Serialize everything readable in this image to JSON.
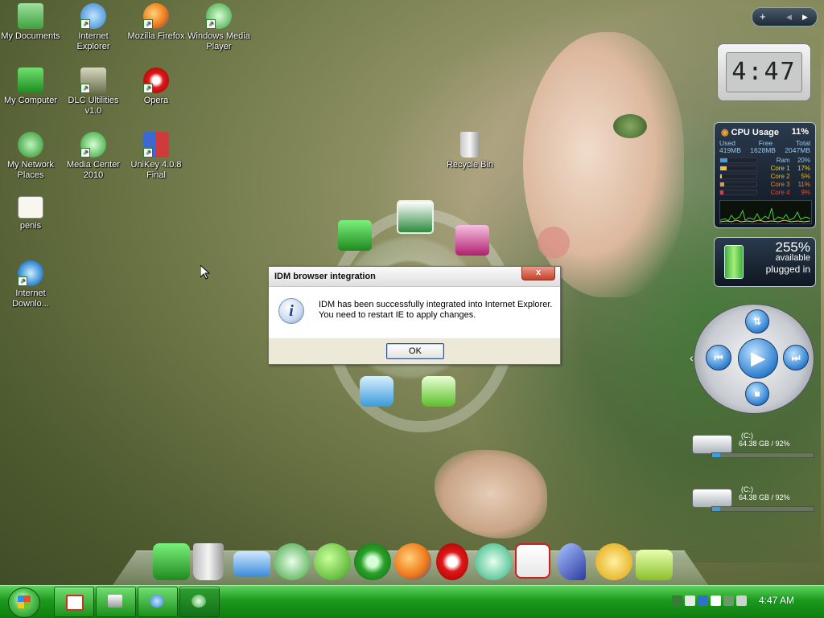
{
  "desktop": {
    "icons": [
      {
        "label": "My Documents",
        "icon": "folder-documents-icon"
      },
      {
        "label": "Internet Explorer",
        "icon": "internet-explorer-icon"
      },
      {
        "label": "Mozilla Firefox",
        "icon": "firefox-icon"
      },
      {
        "label": "Windows Media Player",
        "icon": "media-player-icon"
      },
      {
        "label": "My Computer",
        "icon": "computer-icon"
      },
      {
        "label": "DLC Ultilities v1.0",
        "icon": "tools-icon"
      },
      {
        "label": "Opera",
        "icon": "opera-icon"
      },
      {
        "label": "My Network Places",
        "icon": "network-icon"
      },
      {
        "label": "Media Center 2010",
        "icon": "media-center-icon"
      },
      {
        "label": "UniKey 4.0.8 Final",
        "icon": "unikey-icon"
      },
      {
        "label": "Recycle Bin",
        "icon": "recycle-bin-icon"
      },
      {
        "label": "penis",
        "icon": "image-file-icon"
      },
      {
        "label": "Internet Downlo...",
        "icon": "internet-download-manager-icon"
      }
    ]
  },
  "dialog": {
    "title": "IDM browser integration",
    "close_label": "x",
    "message_line1": "IDM has been successfully integrated into Internet Explorer.",
    "message_line2": "You need to restart IE to apply changes.",
    "ok_label": "OK"
  },
  "gadgets": {
    "toolbar": {
      "add_label": "+",
      "prev_label": "◀",
      "next_label": "▶"
    },
    "clock": {
      "time": "4:47"
    },
    "cpu": {
      "title": "CPU Usage",
      "value": "11%",
      "headers": [
        "Used",
        "Free",
        "Total"
      ],
      "values": [
        "419MB",
        "1628MB",
        "2047MB"
      ],
      "rows": [
        {
          "name": "Ram",
          "value": "20%",
          "fraction": 0.2,
          "color": "#3aa0e6"
        },
        {
          "name": "Core 1",
          "value": "17%",
          "fraction": 0.17,
          "color": "#e6c63a"
        },
        {
          "name": "Core 2",
          "value": "5%",
          "fraction": 0.05,
          "color": "#e6c63a"
        },
        {
          "name": "Core 3",
          "value": "11%",
          "fraction": 0.11,
          "color": "#e69a3a"
        },
        {
          "name": "Core 4",
          "value": "9%",
          "fraction": 0.09,
          "color": "#e63a3a"
        }
      ]
    },
    "battery": {
      "percent": "255%",
      "available": "available",
      "status": "plugged in"
    },
    "drives": [
      {
        "name": "(C:)",
        "usage": "64.38 GB / 92%",
        "fraction": 0.08
      },
      {
        "name": "(C:)",
        "usage": "64.38 GB / 92%",
        "fraction": 0.08
      }
    ]
  },
  "taskbar": {
    "start_icon": "windows-logo-icon",
    "buttons": [
      {
        "icon": "idm-icon",
        "active": false
      },
      {
        "icon": "printer-icon",
        "active": false
      },
      {
        "icon": "internet-explorer-icon",
        "active": false
      },
      {
        "icon": "media-center-icon",
        "active": true
      }
    ],
    "clock": "4:47 AM"
  },
  "colors": {
    "taskbar": "#1c9a1c",
    "dialog_bg": "#ece9d8",
    "close": "#c6412a"
  }
}
